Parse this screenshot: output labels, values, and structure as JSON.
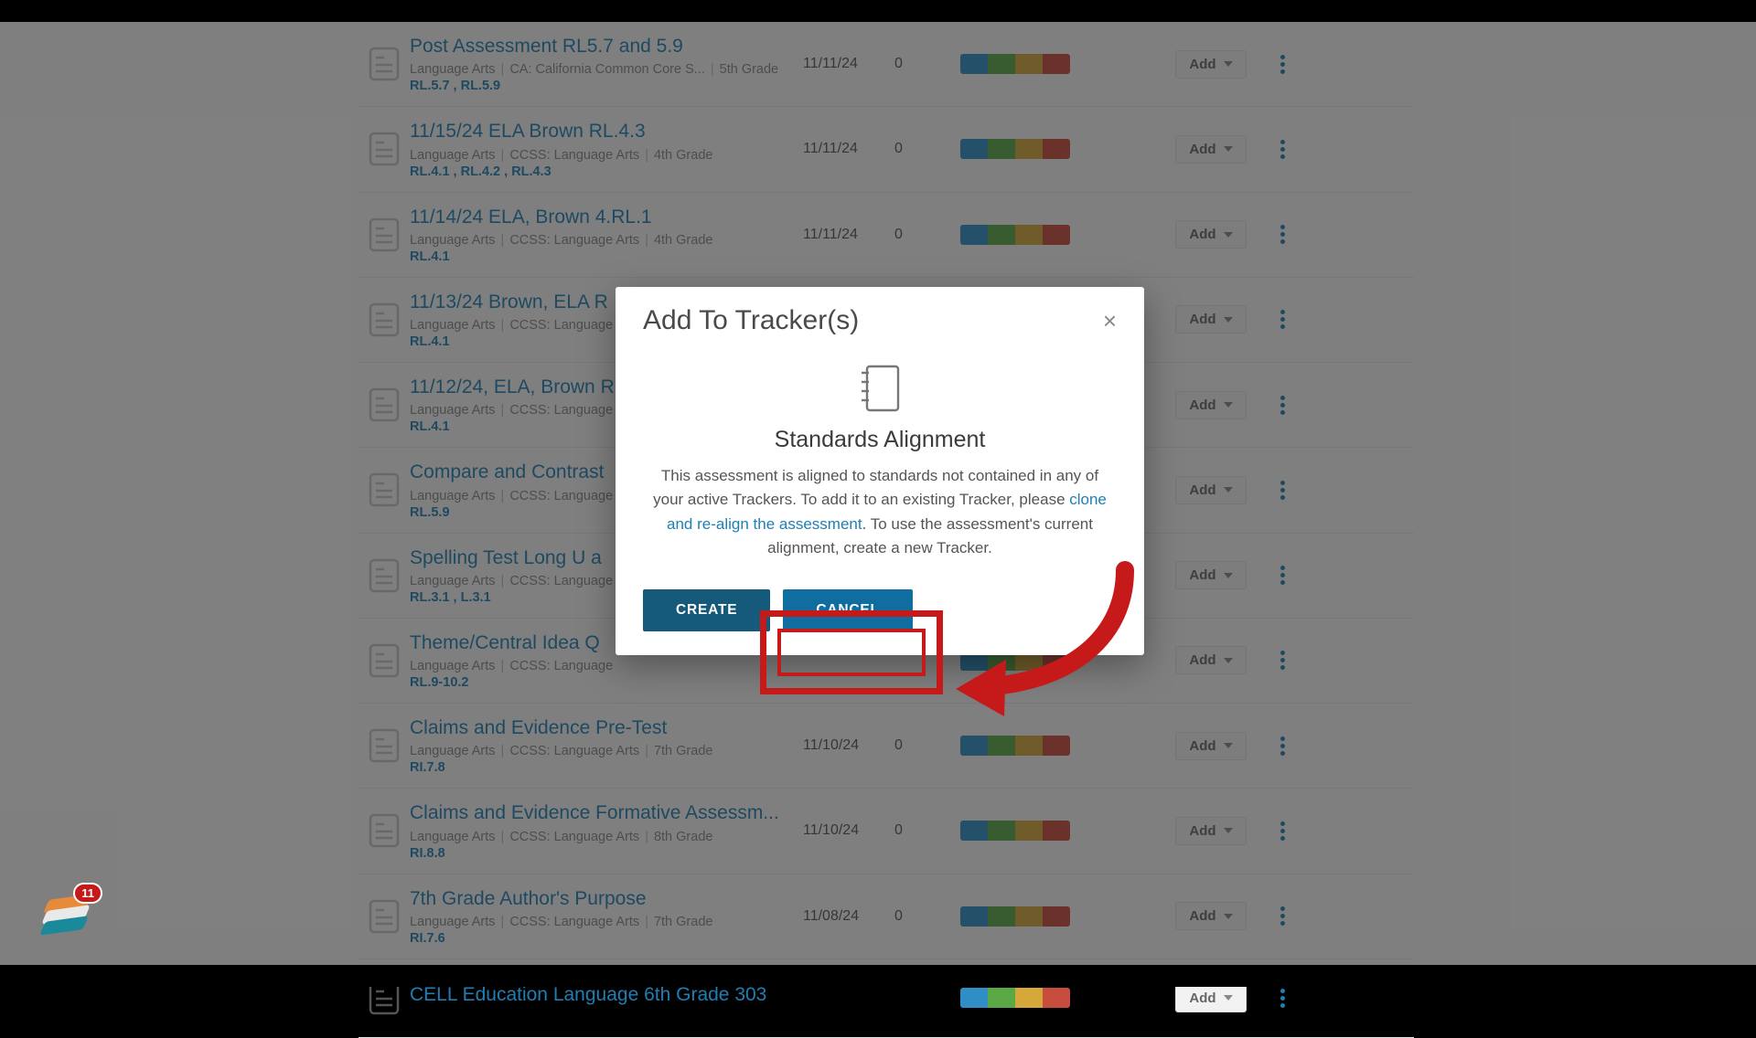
{
  "modal": {
    "title": "Add To Tracker(s)",
    "heading": "Standards Alignment",
    "text_before": "This assessment is aligned to standards not contained in any of your active Trackers. To add it to an existing Tracker, please ",
    "link": "clone and re-align the assessment",
    "text_after": ". To use the assessment's current alignment, create a new Tracker.",
    "create_label": "CREATE",
    "cancel_label": "CANCEL"
  },
  "add_button_label": "Add",
  "notification_count": "11",
  "rows": [
    {
      "title": "Post Assessment RL5.7 and 5.9",
      "subject": "Language Arts",
      "set": "CA: California Common Core S...",
      "grade": "5th Grade",
      "standards": "RL.5.7 , RL.5.9",
      "date": "11/11/24",
      "count": "0"
    },
    {
      "title": "11/15/24 ELA Brown RL.4.3",
      "subject": "Language Arts",
      "set": "CCSS: Language Arts",
      "grade": "4th Grade",
      "standards": "RL.4.1 , RL.4.2 , RL.4.3",
      "date": "11/11/24",
      "count": "0"
    },
    {
      "title": "11/14/24 ELA, Brown 4.RL.1",
      "subject": "Language Arts",
      "set": "CCSS: Language Arts",
      "grade": "4th Grade",
      "standards": "RL.4.1",
      "date": "11/11/24",
      "count": "0"
    },
    {
      "title": "11/13/24 Brown, ELA R",
      "subject": "Language Arts",
      "set": "CCSS: Language",
      "grade": "",
      "standards": "RL.4.1",
      "date": "",
      "count": ""
    },
    {
      "title": "11/12/24, ELA, Brown R",
      "subject": "Language Arts",
      "set": "CCSS: Language",
      "grade": "",
      "standards": "RL.4.1",
      "date": "",
      "count": ""
    },
    {
      "title": "Compare and Contrast",
      "subject": "Language Arts",
      "set": "CCSS: Language",
      "grade": "",
      "standards": "RL.5.9",
      "date": "",
      "count": ""
    },
    {
      "title": "Spelling Test Long U a",
      "subject": "Language Arts",
      "set": "CCSS: Language",
      "grade": "",
      "standards": "RL.3.1 , L.3.1",
      "date": "",
      "count": ""
    },
    {
      "title": "Theme/Central Idea Q",
      "subject": "Language Arts",
      "set": "CCSS: Language",
      "grade": "",
      "standards": "RL.9-10.2",
      "date": "",
      "count": ""
    },
    {
      "title": "Claims and Evidence Pre-Test",
      "subject": "Language Arts",
      "set": "CCSS: Language Arts",
      "grade": "7th Grade",
      "standards": "RI.7.8",
      "date": "11/10/24",
      "count": "0"
    },
    {
      "title": "Claims and Evidence Formative Assessm...",
      "subject": "Language Arts",
      "set": "CCSS: Language Arts",
      "grade": "8th Grade",
      "standards": "RI.8.8",
      "date": "11/10/24",
      "count": "0"
    },
    {
      "title": "7th Grade Author's Purpose",
      "subject": "Language Arts",
      "set": "CCSS: Language Arts",
      "grade": "7th Grade",
      "standards": "RI.7.6",
      "date": "11/08/24",
      "count": "0"
    },
    {
      "title": "CELL Education Language 6th Grade 303",
      "subject": "",
      "set": "",
      "grade": "",
      "standards": "",
      "date": "",
      "count": ""
    }
  ]
}
